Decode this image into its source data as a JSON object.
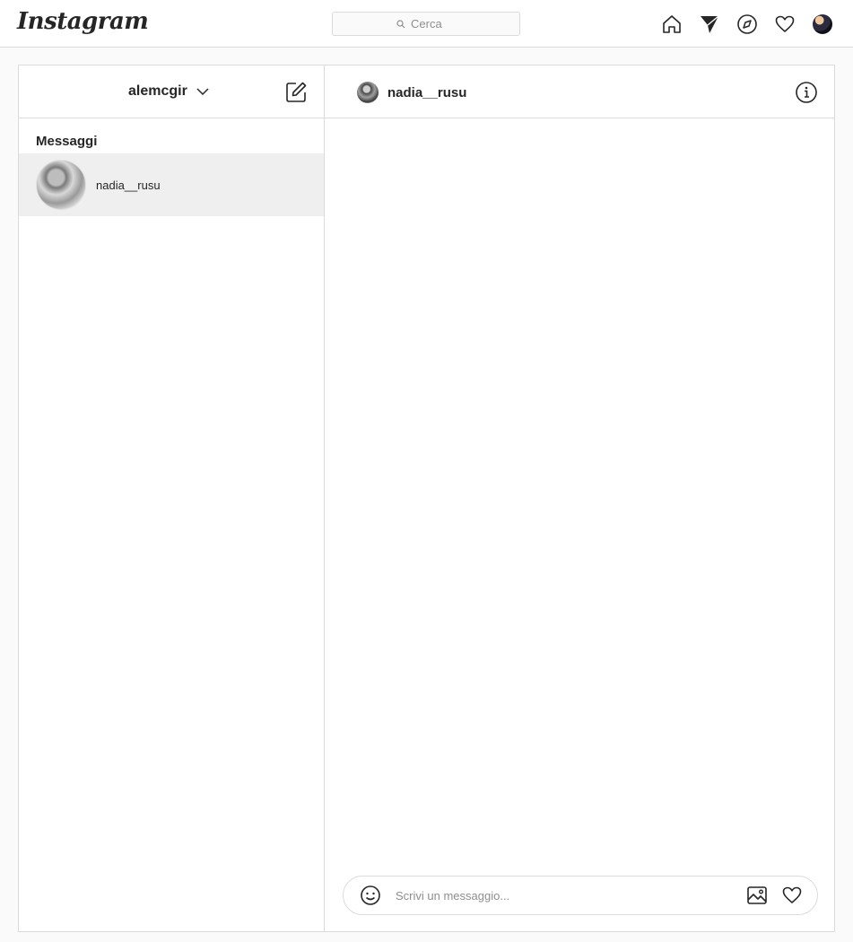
{
  "app": {
    "logo_text": "Instagram"
  },
  "search": {
    "placeholder": "Cerca",
    "value": ""
  },
  "nav": {
    "icons": [
      "home-icon",
      "direct-icon",
      "explore-icon",
      "heart-icon",
      "profile-avatar"
    ]
  },
  "inbox": {
    "account_username": "alemcgir",
    "section_title": "Messaggi",
    "threads": [
      {
        "username": "nadia__rusu",
        "selected": true
      }
    ]
  },
  "chat": {
    "username": "nadia__rusu",
    "composer_placeholder": "Scrivi un messaggio...",
    "composer_value": ""
  },
  "colors": {
    "background": "#fafafa",
    "surface": "#ffffff",
    "border": "#dbdbdb",
    "text_primary": "#262626",
    "text_secondary": "#8e8e8e",
    "selected_thread": "#efefef"
  }
}
